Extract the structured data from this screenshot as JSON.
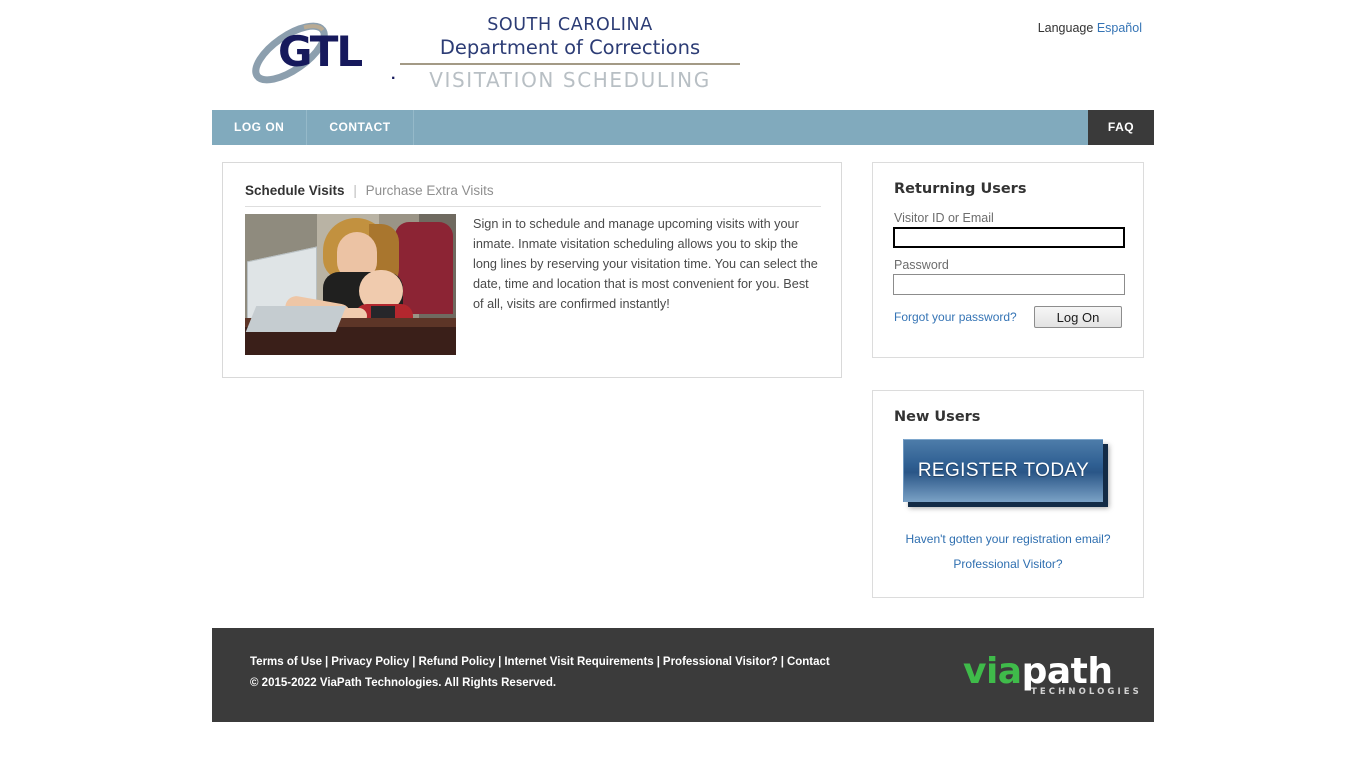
{
  "header": {
    "logo": {
      "brand": "GTL",
      "brand_dot": ".",
      "swoosh_icon": "orbit-swoosh-icon"
    },
    "agency": {
      "line1": "SOUTH CAROLINA",
      "line2": "Department of Corrections",
      "line3": "VISITATION SCHEDULING"
    },
    "language": {
      "label": "Language",
      "option": "Español"
    }
  },
  "nav": {
    "items": [
      {
        "label": "LOG ON",
        "name": "nav-log-on"
      },
      {
        "label": "CONTACT",
        "name": "nav-contact"
      }
    ],
    "faq": "FAQ"
  },
  "main": {
    "tabs": {
      "active": "Schedule Visits",
      "separator": "|",
      "inactive": "Purchase Extra Visits"
    },
    "promo": {
      "image_alt": "woman-with-baby-at-laptop-photo",
      "description": "Sign in to schedule and manage upcoming visits with your inmate. Inmate visitation scheduling allows you to skip the long lines by reserving your visitation time. You can select the date, time and location that is most convenient for you. Best of all, visits are confirmed instantly!"
    }
  },
  "login_panel": {
    "title": "Returning Users",
    "user_label": "Visitor ID or Email",
    "user_value": "",
    "user_placeholder": "",
    "password_label": "Password",
    "password_value": "",
    "password_placeholder": "",
    "forgot_link": "Forgot your password?",
    "submit_label": "Log On"
  },
  "new_users_panel": {
    "title": "New Users",
    "register_label": "REGISTER TODAY",
    "registration_email_link": "Haven't gotten your registration email?",
    "professional_visitor_link": "Professional Visitor?"
  },
  "footer": {
    "links": [
      "Terms of Use",
      "Privacy Policy",
      "Refund Policy",
      "Internet Visit Requirements",
      "Professional Visitor?",
      "Contact"
    ],
    "separator": "|",
    "copyright": "© 2015-2022 ViaPath Technologies. All Rights Reserved.",
    "logo": {
      "part1": "via",
      "part2": "path",
      "tagline": "TECHNOLOGIES"
    }
  },
  "colors": {
    "nav_bar": "#81aabd",
    "faq_tab": "#3a3a3a",
    "footer_bg": "#3b3b3b",
    "agency_navy": "#2c3c75",
    "link_blue": "#3574b5",
    "viapath_green": "#3fbb4a",
    "register_blue": "#2f5f92"
  }
}
